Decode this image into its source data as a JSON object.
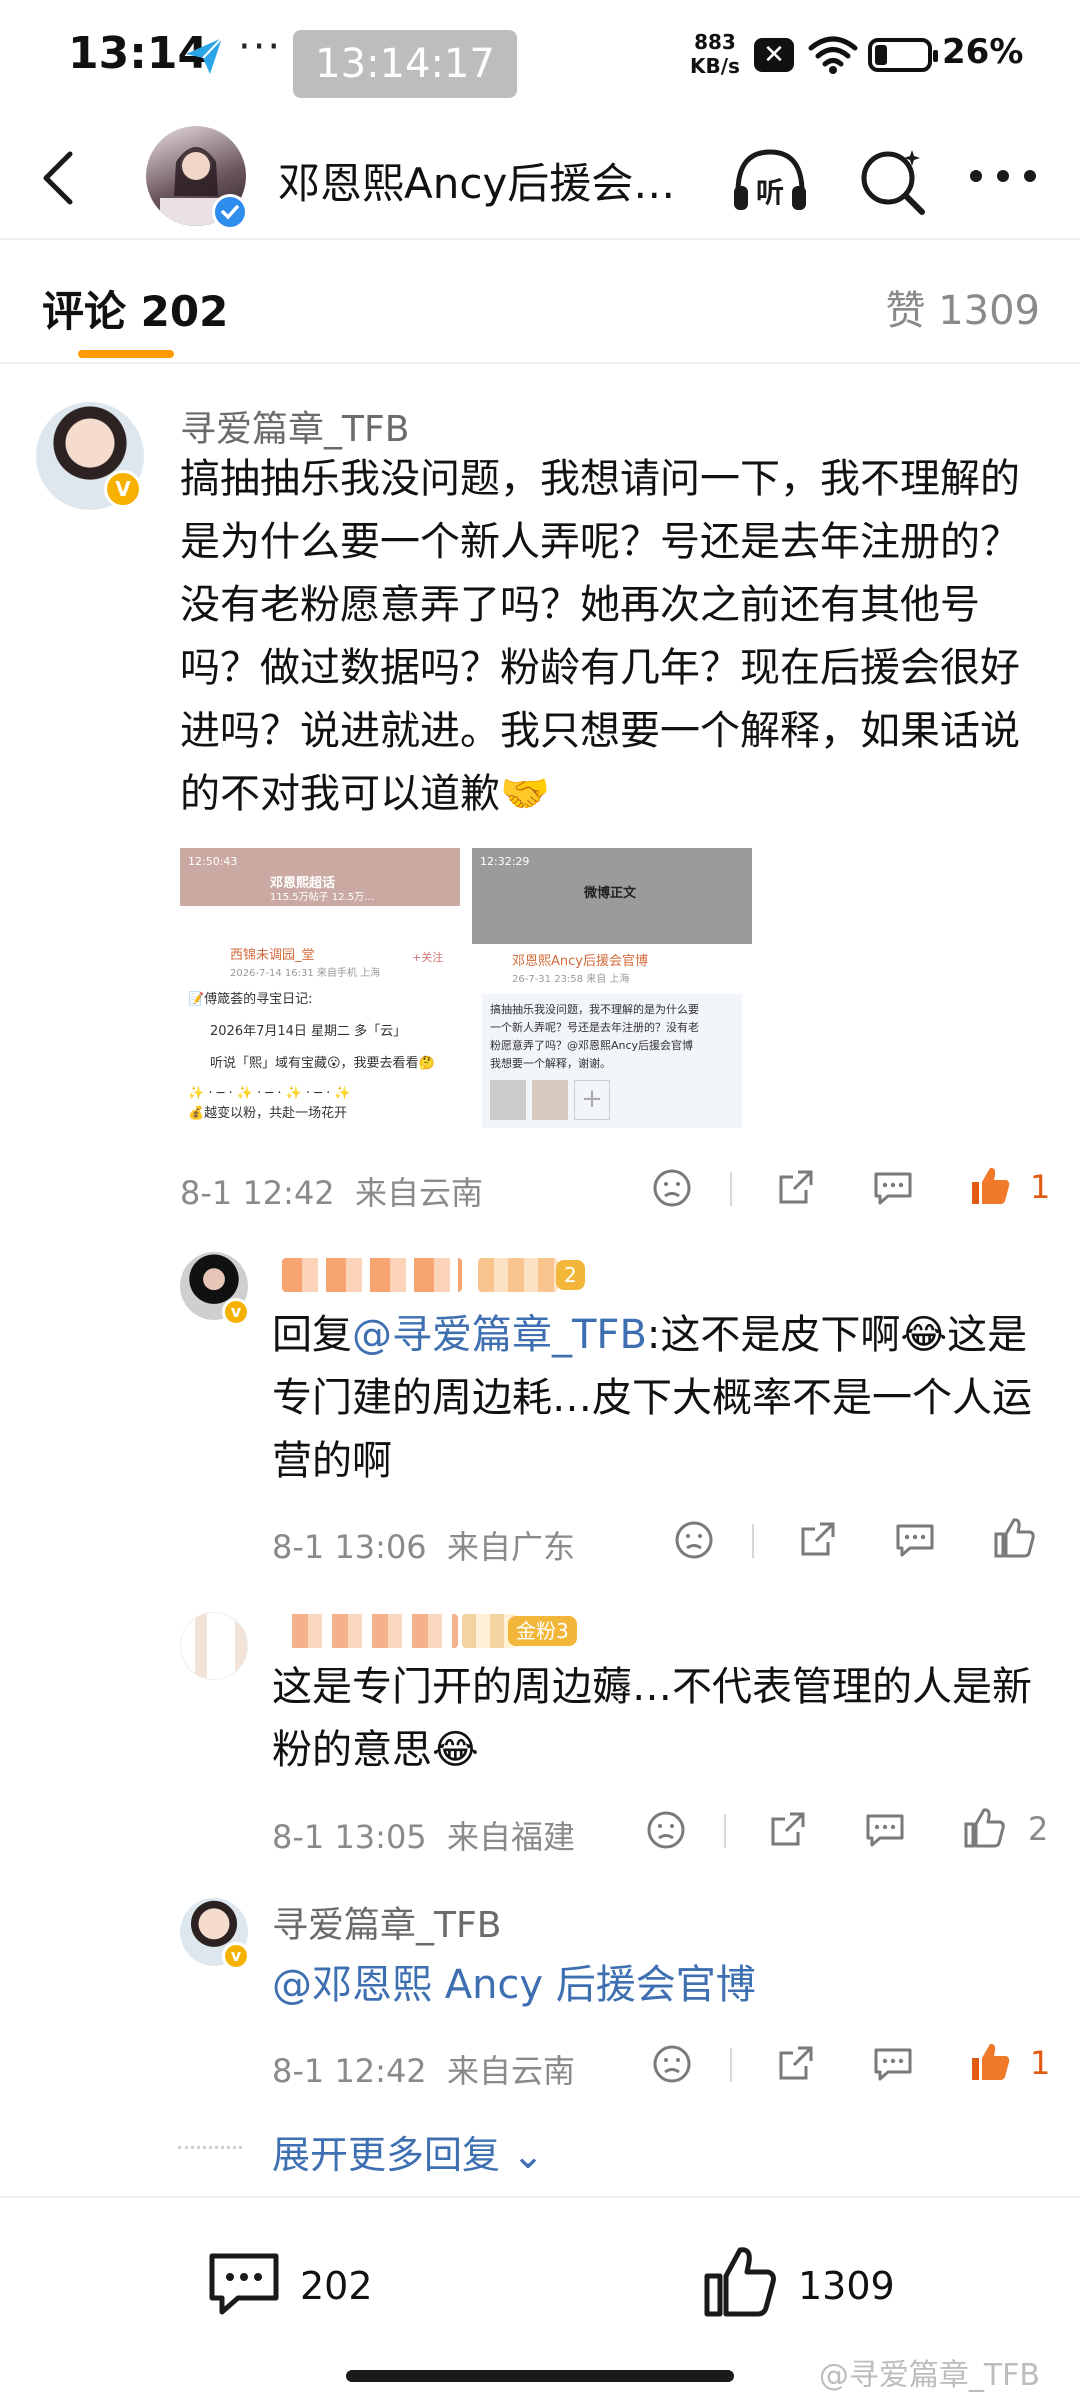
{
  "status_bar": {
    "time": "13:14",
    "dots": "···",
    "clock_overlay": "13:14:17",
    "net_speed_value": "883",
    "net_speed_unit": "KB/s",
    "battery": "26%"
  },
  "header": {
    "title": "邓恩熙Ancy后援会…",
    "listen_label": "听"
  },
  "tabs": {
    "comments": "评论 202",
    "likes": "赞 1309"
  },
  "main_comment": {
    "username": "寻爱篇章_TFB",
    "text": "搞抽抽乐我没问题，我想请问一下，我不理解的是为什么要一个新人弄呢？号还是去年注册的？没有老粉愿意弄了吗？她再次之前还有其他号吗？做过数据吗？粉龄有几年？现在后援会很好进吗？说进就进。我只想要一个解释，如果话说的不对我可以道歉🤝",
    "time": "8-1 12:42",
    "location": "来自云南",
    "likes": "1",
    "images": [
      {
        "title": "邓恩熙超话",
        "subtitle": "115.5万帖子 12.5万…",
        "status_time": "12:50:43",
        "follow": "+关注",
        "poster": "西锦未调园_堂",
        "post_meta": "2026-7-14 16:31 来自手机 上海",
        "lines": [
          "📝傅箴荟的寻宝日记:",
          "2026年7月14日 星期二 多「云」",
          "听说「熙」域有宝藏😮，我要去看看🤔",
          "✨ · ─ · ✨ · ─ · ✨ · ─ · ✨",
          "💰越变以粉，共赴一场花开"
        ]
      },
      {
        "title": "微博正文",
        "status_time": "12:32:29",
        "poster": "邓恩熙Ancy后援会官博",
        "post_meta": "26-7-31 23:58 来自 上海",
        "lines": [
          "搞抽抽乐我没问题，我不理解的是为什么要",
          "一个新人弄呢？号还是去年注册的？没有老",
          "粉愿意弄了吗？@邓恩熙Ancy后援会官博",
          "我想要一个解释，谢谢。"
        ]
      }
    ]
  },
  "replies": [
    {
      "badge": "2",
      "prefix": "回复",
      "mention": "@寻爱篇章_TFB",
      "text": ":这不是皮下啊😂这是专门建的周边耗…皮下大概率不是一个人运营的啊",
      "time": "8-1 13:06",
      "location": "来自广东",
      "likes": ""
    },
    {
      "badge": "金粉3",
      "text": "这是专门开的周边薅…不代表管理的人是新粉的意思😂",
      "time": "8-1 13:05",
      "location": "来自福建",
      "likes": "2"
    },
    {
      "username": "寻爱篇章_TFB",
      "mention": "@邓恩熙 Ancy 后援会官博",
      "time": "8-1 12:42",
      "location": "来自云南",
      "likes": "1"
    }
  ],
  "expand_more": "展开更多回复 ⌄",
  "bottom_bar": {
    "comment_count": "202",
    "like_count": "1309"
  },
  "watermark": "@寻爱篇章_TFB",
  "colors": {
    "accent_orange": "#ff9a00",
    "liked_orange": "#e05a12",
    "link_blue": "#3e6fb1",
    "verified_gold": "#f6b100"
  }
}
